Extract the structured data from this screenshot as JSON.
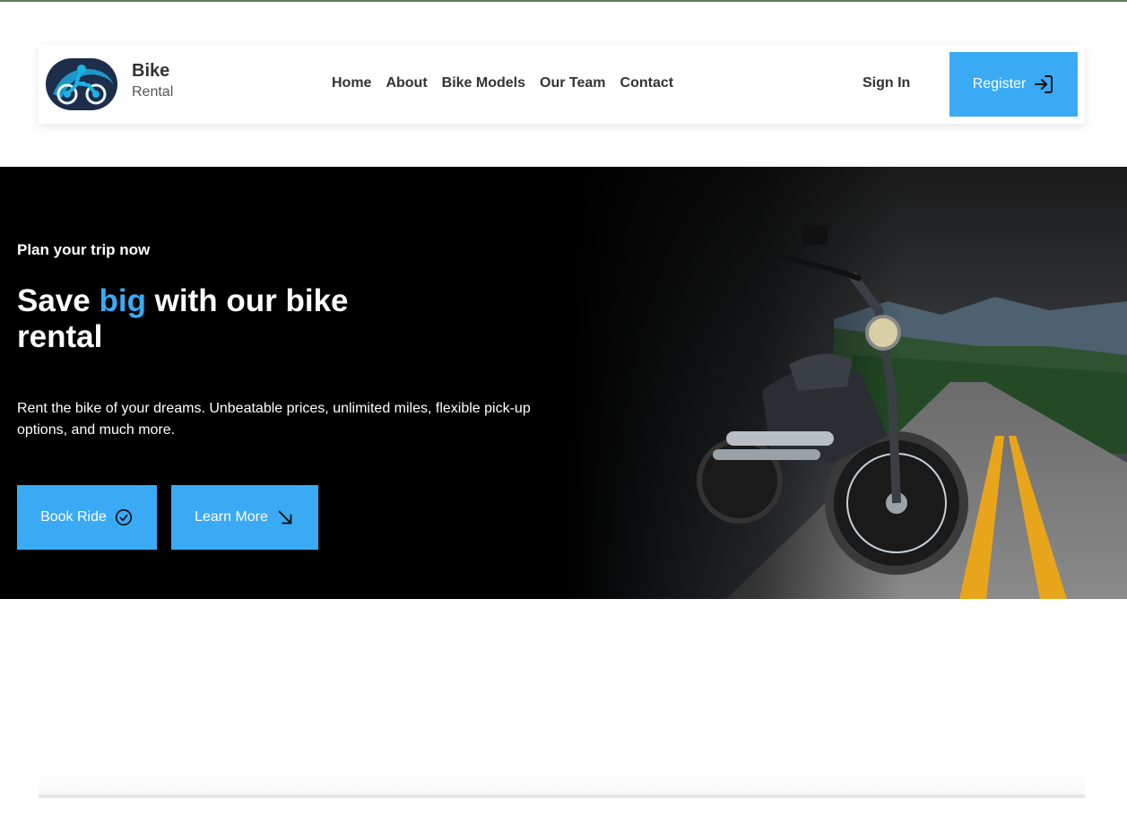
{
  "brand": {
    "name_line1": "Bike",
    "name_line2": "Rental",
    "logo_icon": "motorcycle-rider-icon"
  },
  "nav": {
    "items": [
      {
        "label": "Home"
      },
      {
        "label": "About"
      },
      {
        "label": "Bike Models"
      },
      {
        "label": "Our Team"
      },
      {
        "label": "Contact"
      }
    ],
    "sign_in": "Sign In",
    "register": "Register",
    "register_icon": "sign-in-arrow-icon"
  },
  "hero": {
    "subtitle": "Plan your trip now",
    "title_part1": "Save ",
    "title_accent": "big",
    "title_part2": " with our bike rental",
    "description": "Rent the bike of your dreams. Unbeatable prices, unlimited miles, flexible pick-up options, and much more.",
    "book_ride": "Book Ride",
    "book_icon": "check-circle-icon",
    "learn_more": "Learn More",
    "learn_icon": "arrow-down-right-icon"
  },
  "colors": {
    "accent": "#3aaaf5",
    "hero_bg": "#000000",
    "logo_bg": "#1e2d4a"
  }
}
